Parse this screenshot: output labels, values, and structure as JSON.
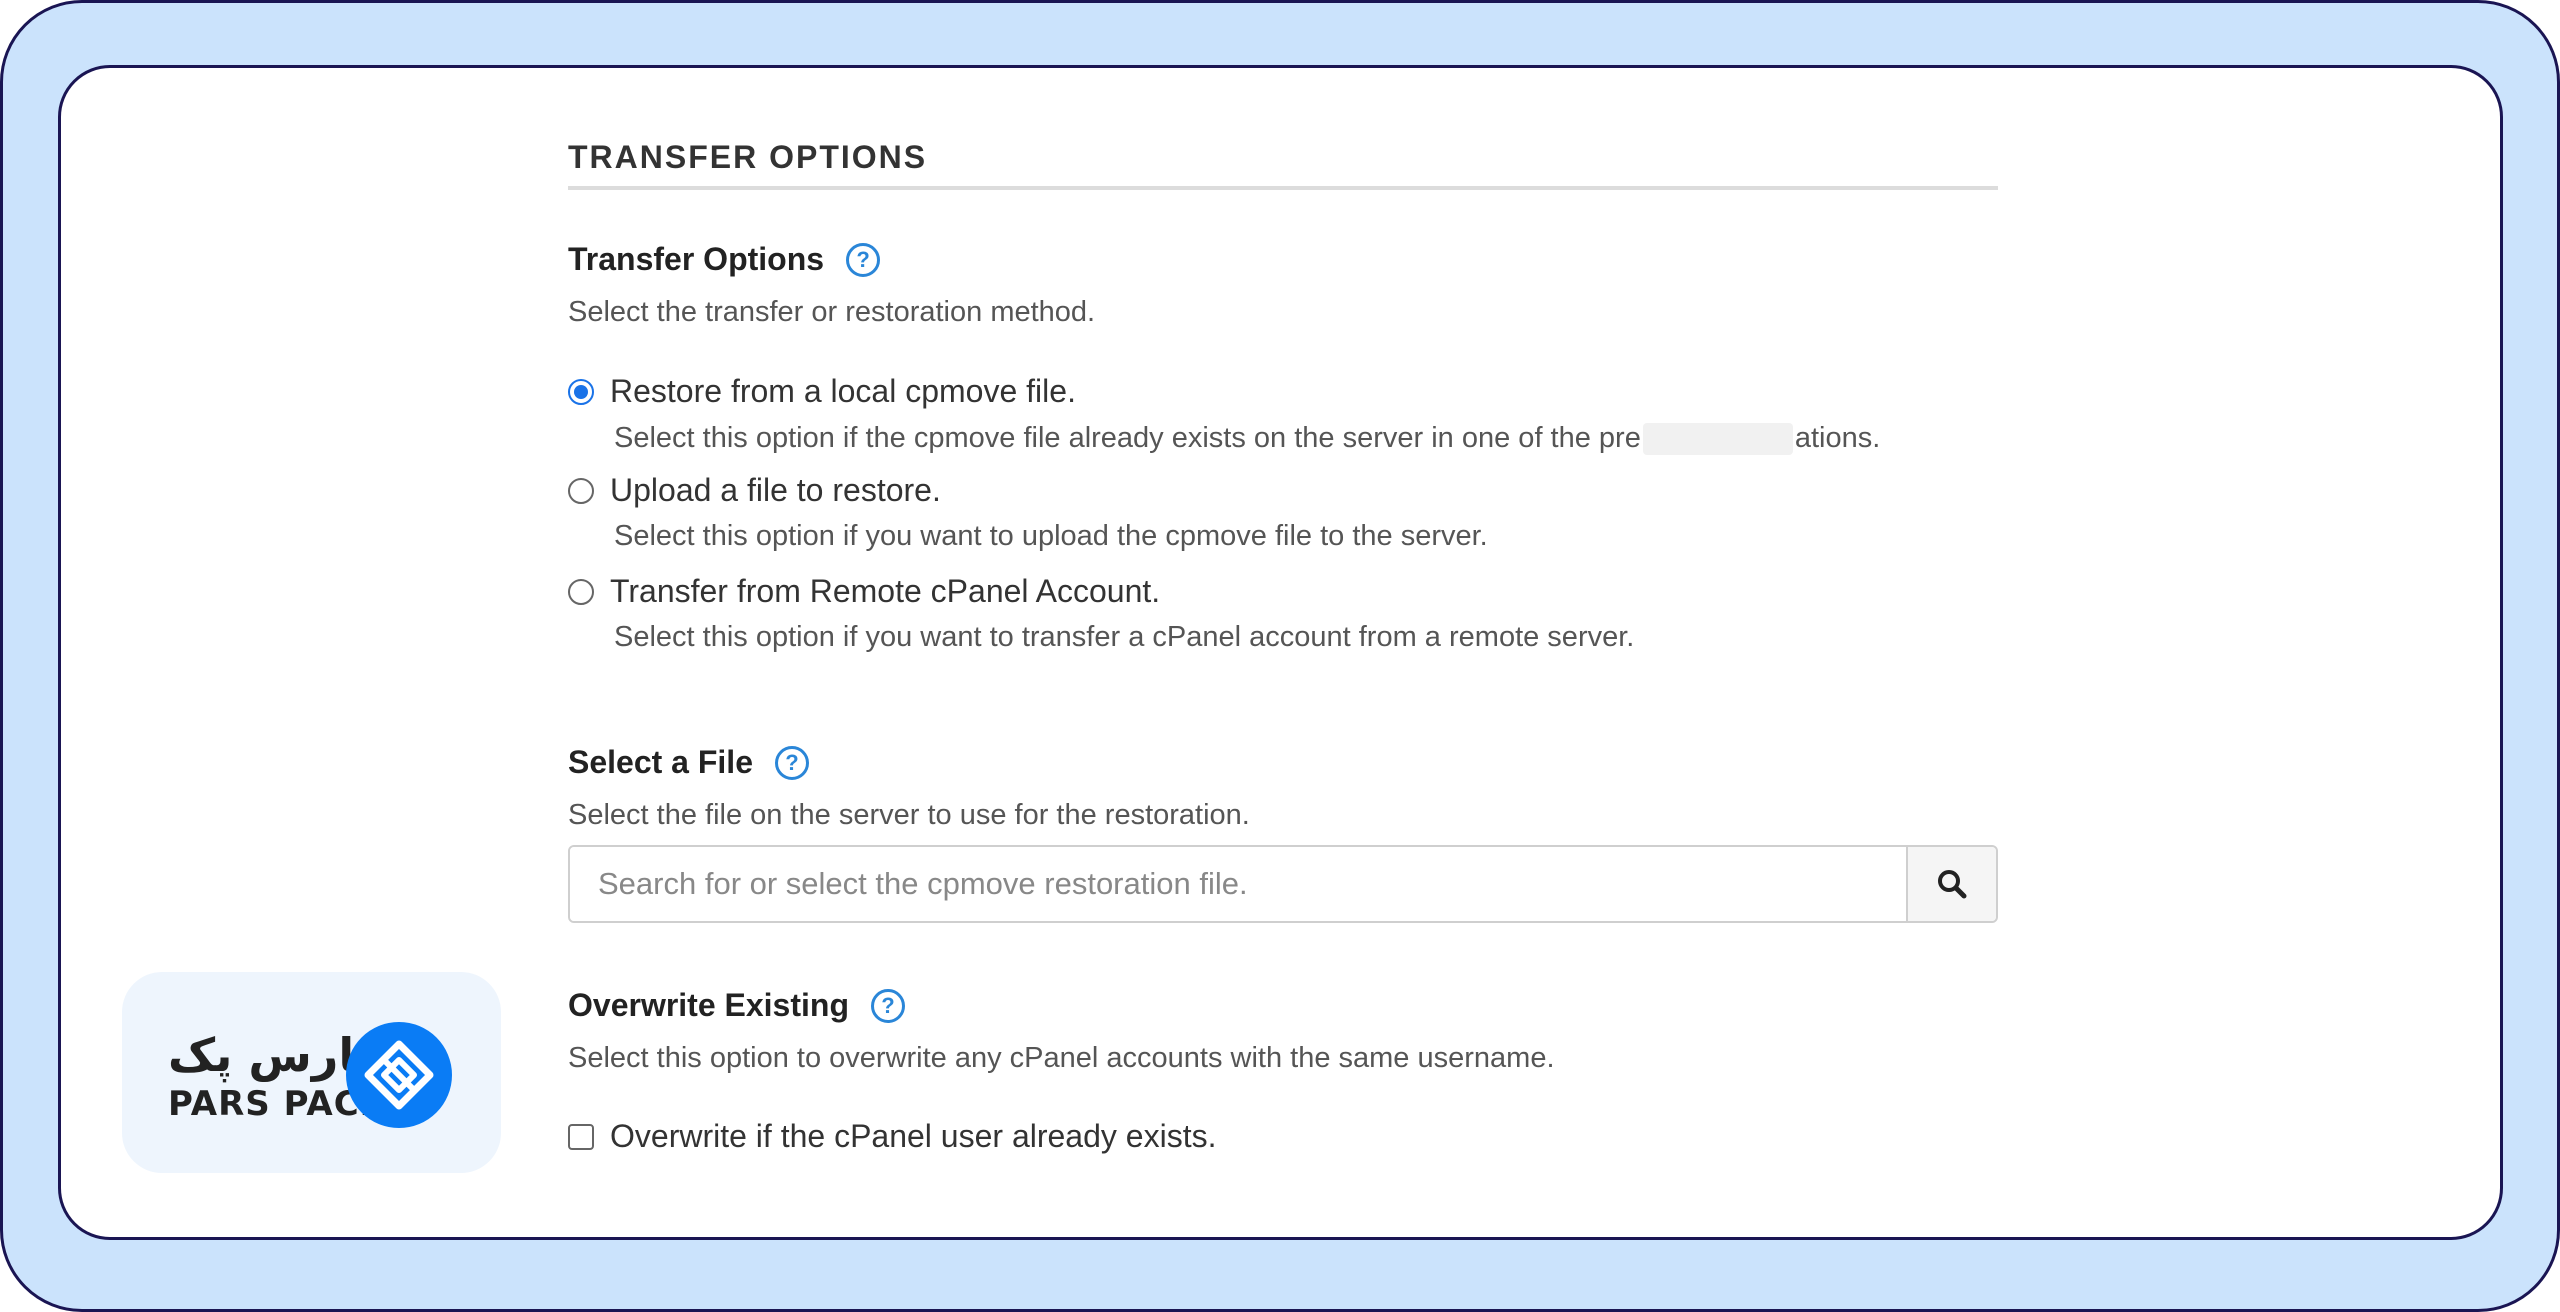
{
  "section": {
    "header": "TRANSFER OPTIONS"
  },
  "transfer_options": {
    "title": "Transfer Options",
    "description": "Select the transfer or restoration method.",
    "options": [
      {
        "label": "Restore from a local cpmove file.",
        "description_start": "Select this option if the cpmove file already exists on the server in one of the pre",
        "description_end": "ations.",
        "selected": true
      },
      {
        "label": "Upload a file to restore.",
        "description": "Select this option if you want to upload the cpmove file to the server.",
        "selected": false
      },
      {
        "label": "Transfer from Remote cPanel Account.",
        "description": "Select this option if you want to transfer a cPanel account from a remote server.",
        "selected": false
      }
    ]
  },
  "select_file": {
    "title": "Select a File",
    "description": "Select the file on the server to use for the restoration.",
    "placeholder": "Search for or select the cpmove restoration file."
  },
  "overwrite": {
    "title": "Overwrite Existing",
    "description": "Select this option to overwrite any cPanel accounts with the same username.",
    "checkbox_label": "Overwrite if the cPanel user already exists.",
    "checked": false
  },
  "logo": {
    "text_fa": "پارس پک",
    "text_en": "PARS PACK",
    "accent_color": "#0a7cf5"
  },
  "help_icon_glyph": "?"
}
